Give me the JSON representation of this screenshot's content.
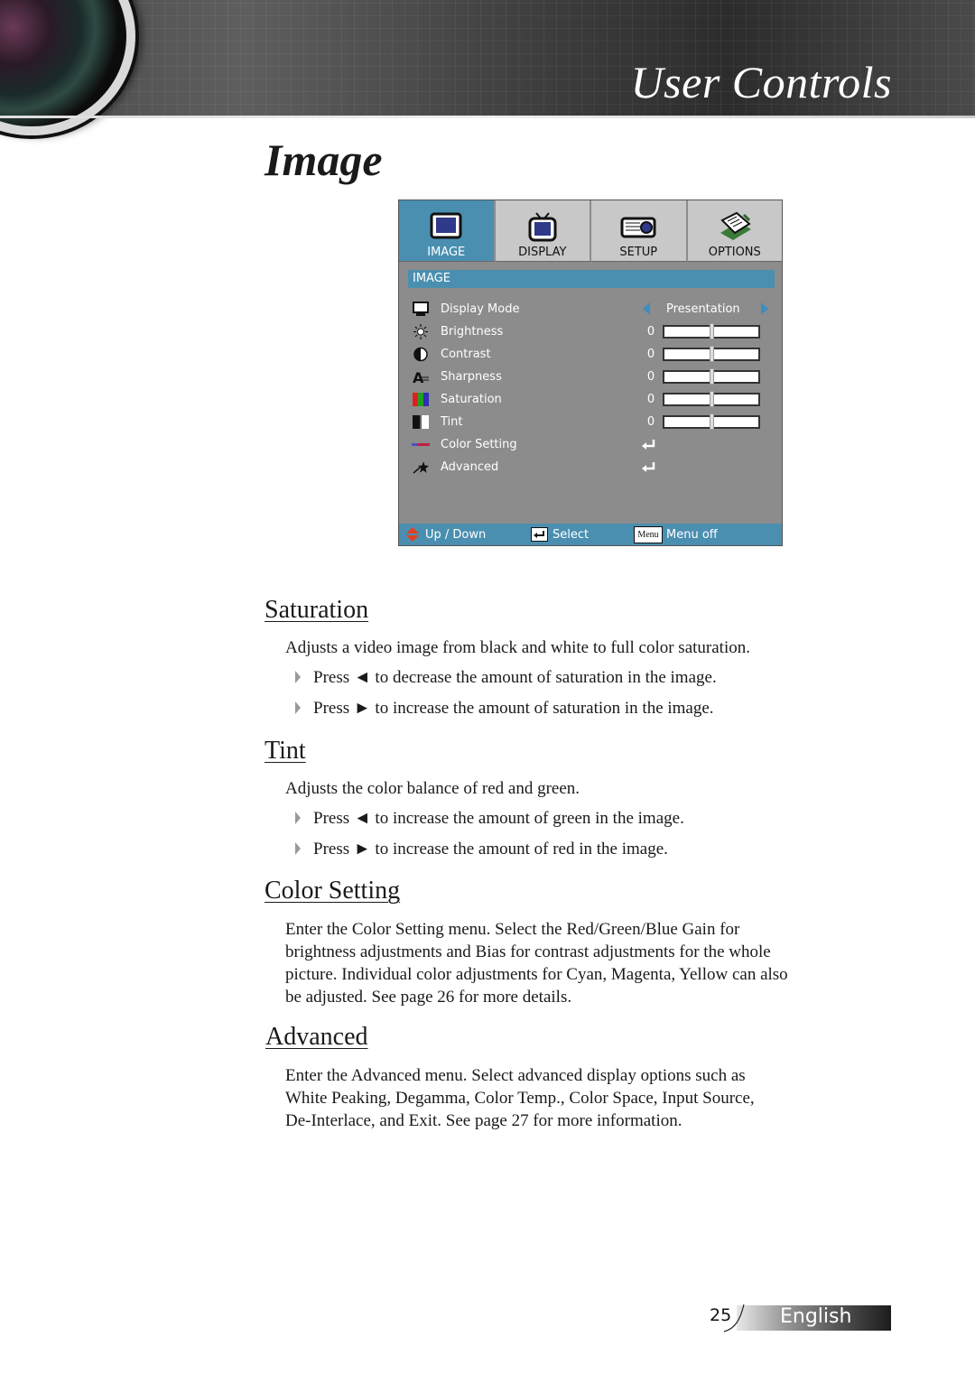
{
  "header": {
    "banner_title": "User Controls"
  },
  "page_title": "Image",
  "osd": {
    "tabs": [
      {
        "label": "IMAGE",
        "icon": "monitor-icon",
        "active": true
      },
      {
        "label": "DISPLAY",
        "icon": "tv-icon",
        "active": false
      },
      {
        "label": "SETUP",
        "icon": "projector-icon",
        "active": false
      },
      {
        "label": "OPTIONS",
        "icon": "notepad-icon",
        "active": false
      }
    ],
    "section_title": "IMAGE",
    "items": [
      {
        "label": "Display Mode",
        "icon": "monitor-icon",
        "value": "Presentation",
        "type": "select"
      },
      {
        "label": "Brightness",
        "icon": "sun-icon",
        "value": "0",
        "type": "slider",
        "level": 0.5
      },
      {
        "label": "Contrast",
        "icon": "contrast-icon",
        "value": "0",
        "type": "slider",
        "level": 0.5
      },
      {
        "label": "Sharpness",
        "icon": "sharpness-icon",
        "value": "0",
        "type": "slider",
        "level": 0.5
      },
      {
        "label": "Saturation",
        "icon": "color-bars-icon",
        "value": "0",
        "type": "slider",
        "level": 0.5
      },
      {
        "label": "Tint",
        "icon": "tint-icon",
        "value": "0",
        "type": "slider",
        "level": 0.5
      },
      {
        "label": "Color Setting",
        "icon": "color-setting-icon",
        "type": "enter"
      },
      {
        "label": "Advanced",
        "icon": "advanced-icon",
        "type": "enter"
      }
    ],
    "footer": {
      "updown": "Up / Down",
      "select": "Select",
      "menu_key": "Menu",
      "menu_off": "Menu off"
    }
  },
  "sections": {
    "saturation": {
      "heading": "Saturation",
      "desc": "Adjusts a video image from black and white to full color saturation.",
      "bullets": [
        "Press ◄ to decrease the amount of saturation in the image.",
        "Press ► to increase the amount of saturation in the image."
      ]
    },
    "tint": {
      "heading": "Tint",
      "desc": "Adjusts the color balance of red and green.",
      "bullets": [
        "Press ◄ to increase the amount of green in the image.",
        "Press ► to increase the amount of red in the image."
      ]
    },
    "color_setting": {
      "heading": "Color Setting",
      "lines": [
        "Enter the Color Setting menu. Select the Red/Green/Blue Gain for",
        "brightness adjustments and Bias for contrast adjustments for the whole",
        "picture. Individual color adjustments for Cyan, Magenta, Yellow can also",
        "be adjusted. See page 26 for more details."
      ]
    },
    "advanced": {
      "heading": "Advanced",
      "lines": [
        "Enter the Advanced menu. Select advanced display options such as",
        "White Peaking, Degamma, Color Temp., Color Space, Input Source,",
        "De-Interlace, and Exit. See page 27 for more information."
      ]
    }
  },
  "footer": {
    "page_number": "25",
    "language": "English"
  }
}
